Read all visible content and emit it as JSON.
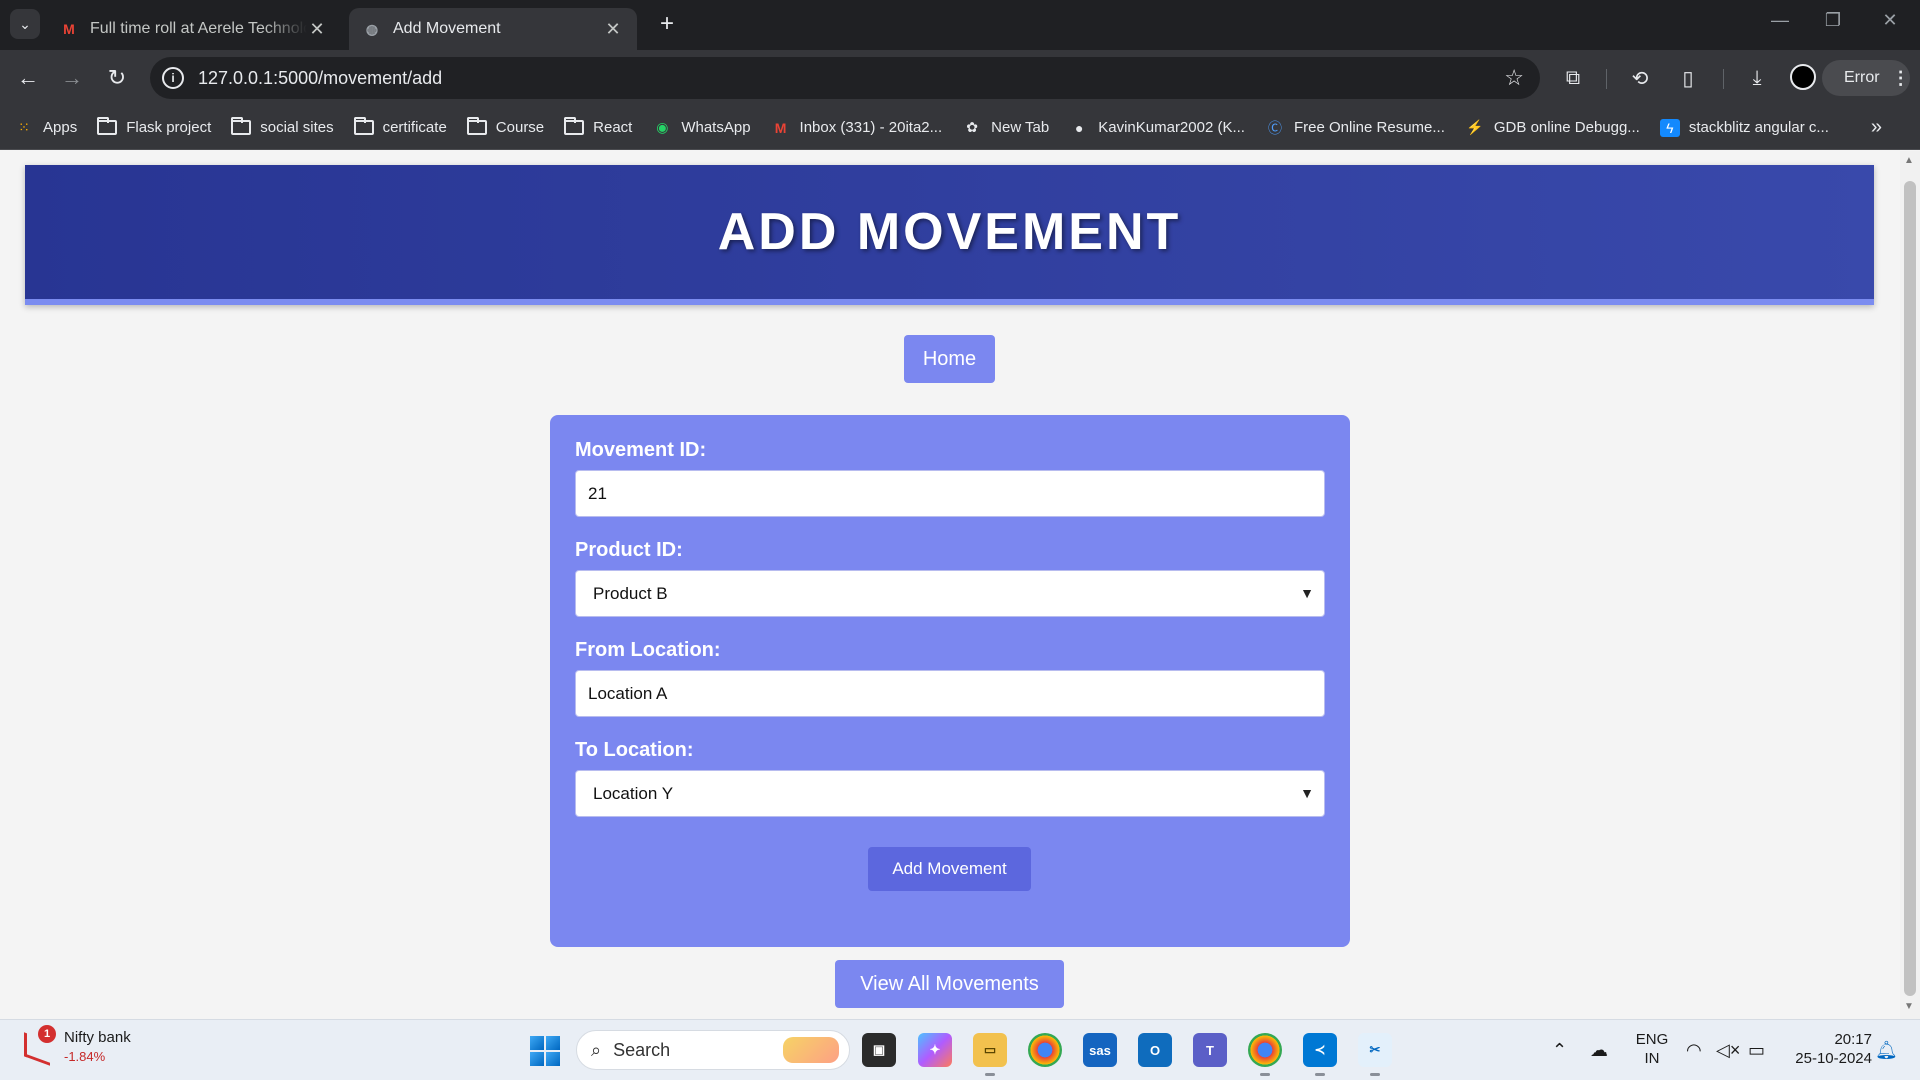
{
  "browser": {
    "tabs": [
      {
        "title": "Full time roll at Aerele Technolo",
        "active": false,
        "icon": "gmail-icon"
      },
      {
        "title": "Add Movement",
        "active": true,
        "icon": "globe-icon"
      }
    ],
    "url": "127.0.0.1:5000/movement/add",
    "profile_button": "Error",
    "bookmarks": [
      {
        "label": "Apps",
        "icon": "apps-grid-icon"
      },
      {
        "label": "Flask project",
        "icon": "folder-icon"
      },
      {
        "label": "social sites",
        "icon": "folder-icon"
      },
      {
        "label": "certificate",
        "icon": "folder-icon"
      },
      {
        "label": "Course",
        "icon": "folder-icon"
      },
      {
        "label": "React",
        "icon": "folder-icon"
      },
      {
        "label": "WhatsApp",
        "icon": "whatsapp-icon"
      },
      {
        "label": "Inbox (331) - 20ita2...",
        "icon": "gmail-icon"
      },
      {
        "label": "New Tab",
        "icon": "chatgpt-icon"
      },
      {
        "label": "KavinKumar2002 (K...",
        "icon": "github-icon"
      },
      {
        "label": "Free Online Resume...",
        "icon": "resume-icon"
      },
      {
        "label": "GDB online Debugg...",
        "icon": "gdb-icon"
      },
      {
        "label": "stackblitz angular c...",
        "icon": "stackblitz-icon"
      }
    ]
  },
  "page": {
    "header_title": "ADD MOVEMENT",
    "home_button": "Home",
    "form": {
      "movement_id_label": "Movement ID:",
      "movement_id_value": "21",
      "product_id_label": "Product ID:",
      "product_id_selected": "Product B",
      "from_location_label": "From Location:",
      "from_location_value": "Location A",
      "to_location_label": "To Location:",
      "to_location_selected": "Location Y",
      "submit_button": "Add Movement"
    },
    "view_all_button": "View All Movements"
  },
  "taskbar": {
    "widget_name": "Nifty bank",
    "widget_value": "-1.84%",
    "widget_badge": "1",
    "search_placeholder": "Search",
    "apps": [
      "task-view-icon",
      "copilot-icon",
      "file-explorer-icon",
      "chrome-icon",
      "sas-icon",
      "outlook-icon",
      "teams-icon",
      "chrome-profile-icon",
      "vscode-icon",
      "snipping-tool-icon"
    ],
    "sas_label": "sas",
    "language_top": "ENG",
    "language_bottom": "IN",
    "time": "20:17",
    "date": "25-10-2024"
  },
  "colors": {
    "header_start": "#283593",
    "header_end": "#3949ab",
    "form_bg": "#7b87f0",
    "submit_bg": "#5c67de"
  }
}
